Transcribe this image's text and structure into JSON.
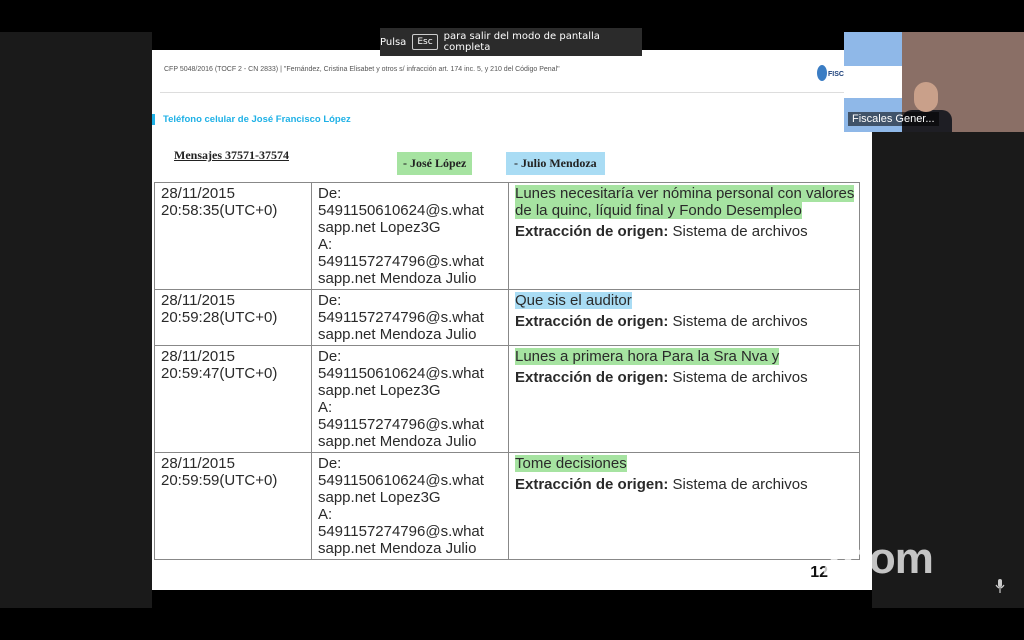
{
  "banner": {
    "pre": "Pulsa",
    "key": "Esc",
    "post": "para salir del modo de pantalla completa"
  },
  "slide": {
    "header": "CFP 5048/2016 (TOCF 2 - CN 2833) | \"Fernández, Cristina Elisabet y otros s/ infracción art. 174 inc. 5, y 210 del Código Penal\"",
    "section_title": "Teléfono celular de José Francisco López",
    "messages_label": "Mensajes 37571-37574",
    "legend": {
      "jose": "- José López",
      "julio": "- Julio Mendoza"
    },
    "page_number": "12",
    "rows": [
      {
        "time": [
          "28/11/2015",
          "20:58:35(UTC+0)"
        ],
        "from": [
          "De:",
          "5491150610624@s.what",
          "sapp.net Lopez3G",
          "A:",
          "5491157274796@s.what",
          "sapp.net Mendoza Julio"
        ],
        "message": "Lunes necesitaría ver nómina personal con valores de la quinc, líquid final y Fondo Desempleo",
        "speaker": "jose",
        "extraction_label": "Extracción de origen:",
        "extraction_value": "Sistema de archivos"
      },
      {
        "time": [
          "28/11/2015",
          "20:59:28(UTC+0)"
        ],
        "from": [
          "De:",
          "5491157274796@s.what",
          "sapp.net Mendoza Julio"
        ],
        "message": "Que sis el auditor",
        "speaker": "julio",
        "extraction_label": "Extracción de origen:",
        "extraction_value": "Sistema de archivos"
      },
      {
        "time": [
          "28/11/2015",
          "20:59:47(UTC+0)"
        ],
        "from": [
          "De:",
          "5491150610624@s.what",
          "sapp.net Lopez3G",
          "A:",
          "5491157274796@s.what",
          "sapp.net Mendoza Julio"
        ],
        "message": "Lunes a primera hora Para la Sra Nva y",
        "speaker": "jose",
        "extraction_label": "Extracción de origen:",
        "extraction_value": "Sistema de archivos"
      },
      {
        "time": [
          "28/11/2015",
          "20:59:59(UTC+0)"
        ],
        "from": [
          "De:",
          "5491150610624@s.what",
          "sapp.net Lopez3G",
          "A:",
          "5491157274796@s.what",
          "sapp.net Mendoza Julio"
        ],
        "message": "Tome decisiones",
        "speaker": "jose",
        "extraction_label": "Extracción de origen:",
        "extraction_value": "Sistema de archivos"
      }
    ]
  },
  "video": {
    "participant_name": "Fiscales Gener..."
  },
  "watermark": {
    "text": "zoom"
  },
  "icons": {
    "org_logo": "fisc-logo-icon",
    "mic": "microphone-icon"
  },
  "colors": {
    "jose": "#a6e3a1",
    "julio": "#a9dcf4",
    "title": "#1fb1e6"
  }
}
